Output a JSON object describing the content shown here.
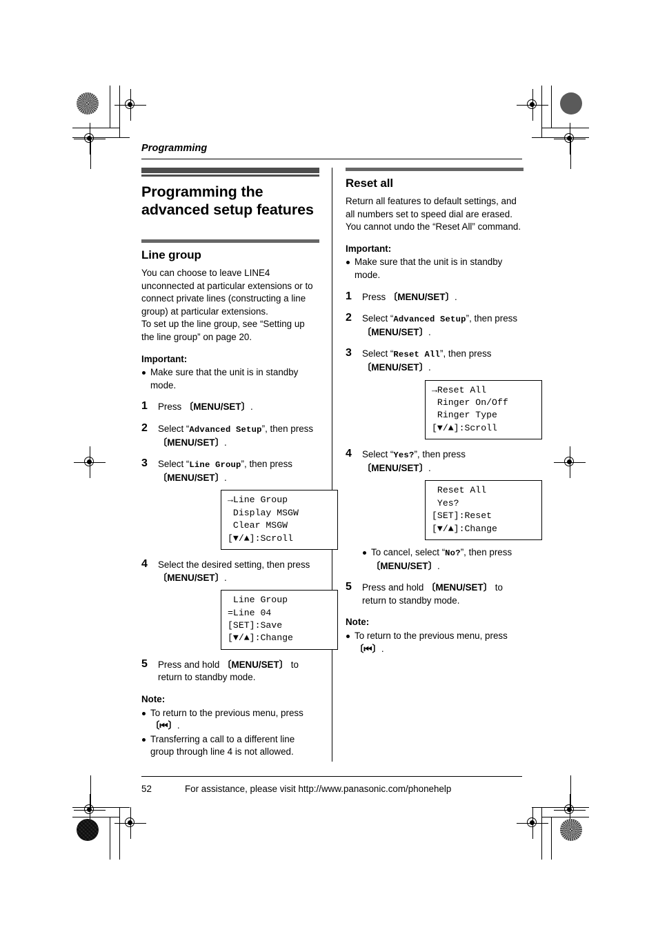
{
  "page": {
    "running_head": "Programming",
    "footer_page_number": "52",
    "footer_text": "For assistance, please visit http://www.panasonic.com/phonehelp"
  },
  "colors": {
    "heading_bar_dark": "#4d4d4d",
    "heading_bar_gray": "#666666",
    "rule": "#000000",
    "text": "#000000"
  },
  "left_column": {
    "title": "Programming the advanced setup features",
    "section": {
      "heading": "Line group",
      "intro": "You can choose to leave LINE4 unconnected at particular extensions or to connect private lines (constructing a line group) at particular extensions.\nTo set up the line group, see “Setting up the line group” on page 20.",
      "important_label": "Important:",
      "important_bullets": [
        "Make sure that the unit is in standby mode."
      ],
      "steps": [
        {
          "num": "1",
          "parts": [
            {
              "t": "text",
              "v": "Press "
            },
            {
              "t": "key",
              "v": "〔MENU/SET〕"
            },
            {
              "t": "text",
              "v": "."
            }
          ]
        },
        {
          "num": "2",
          "parts": [
            {
              "t": "text",
              "v": "Select “"
            },
            {
              "t": "mono",
              "v": "Advanced Setup"
            },
            {
              "t": "text",
              "v": "”, then press "
            },
            {
              "t": "key",
              "v": "〔MENU/SET〕"
            },
            {
              "t": "text",
              "v": "."
            }
          ]
        },
        {
          "num": "3",
          "parts": [
            {
              "t": "text",
              "v": "Select “"
            },
            {
              "t": "mono",
              "v": "Line Group"
            },
            {
              "t": "text",
              "v": "”, then press "
            },
            {
              "t": "key",
              "v": "〔MENU/SET〕"
            },
            {
              "t": "text",
              "v": "."
            }
          ],
          "lcd": [
            "→Line Group",
            " Display MSGW",
            " Clear MSGW",
            "[▼/▲]:Scroll"
          ]
        },
        {
          "num": "4",
          "parts": [
            {
              "t": "text",
              "v": "Select the desired setting, then press "
            },
            {
              "t": "key",
              "v": "〔MENU/SET〕"
            },
            {
              "t": "text",
              "v": "."
            }
          ],
          "lcd": [
            " Line Group",
            "=Line 04",
            "[SET]:Save",
            "[▼/▲]:Change"
          ]
        },
        {
          "num": "5",
          "parts": [
            {
              "t": "text",
              "v": "Press and hold "
            },
            {
              "t": "key",
              "v": "〔MENU/SET〕"
            },
            {
              "t": "text",
              "v": " to return to standby mode."
            }
          ]
        }
      ],
      "note_label": "Note:",
      "note_bullets": [
        {
          "pre": "To return to the previous menu, press ",
          "key": "〔⏮〕",
          "post": "."
        },
        {
          "pre": "Transferring a call to a different line group through line 4 is not allowed.",
          "key": "",
          "post": ""
        }
      ]
    }
  },
  "right_column": {
    "section": {
      "heading": "Reset all",
      "intro": "Return all features to default settings, and all numbers set to speed dial are erased. You cannot undo the “Reset All” command.",
      "important_label": "Important:",
      "important_bullets": [
        "Make sure that the unit is in standby mode."
      ],
      "steps": [
        {
          "num": "1",
          "parts": [
            {
              "t": "text",
              "v": "Press "
            },
            {
              "t": "key",
              "v": "〔MENU/SET〕"
            },
            {
              "t": "text",
              "v": "."
            }
          ]
        },
        {
          "num": "2",
          "parts": [
            {
              "t": "text",
              "v": "Select “"
            },
            {
              "t": "mono",
              "v": "Advanced Setup"
            },
            {
              "t": "text",
              "v": "”, then press "
            },
            {
              "t": "key",
              "v": "〔MENU/SET〕"
            },
            {
              "t": "text",
              "v": "."
            }
          ]
        },
        {
          "num": "3",
          "parts": [
            {
              "t": "text",
              "v": "Select “"
            },
            {
              "t": "mono",
              "v": "Reset All"
            },
            {
              "t": "text",
              "v": "”, then press "
            },
            {
              "t": "key",
              "v": "〔MENU/SET〕"
            },
            {
              "t": "text",
              "v": "."
            }
          ],
          "lcd": [
            "→Reset All",
            " Ringer On/Off",
            " Ringer Type",
            "[▼/▲]:Scroll"
          ]
        },
        {
          "num": "4",
          "parts": [
            {
              "t": "text",
              "v": "Select “"
            },
            {
              "t": "mono",
              "v": "Yes?"
            },
            {
              "t": "text",
              "v": "”, then press "
            },
            {
              "t": "key",
              "v": "〔MENU/SET〕"
            },
            {
              "t": "text",
              "v": "."
            }
          ],
          "lcd": [
            " Reset All",
            " Yes?",
            "[SET]:Reset",
            "[▼/▲]:Change"
          ],
          "sub_bullet": [
            {
              "t": "text",
              "v": "To cancel, select “"
            },
            {
              "t": "mono",
              "v": "No?"
            },
            {
              "t": "text",
              "v": "”, then press "
            },
            {
              "t": "key",
              "v": "〔MENU/SET〕"
            },
            {
              "t": "text",
              "v": "."
            }
          ]
        },
        {
          "num": "5",
          "parts": [
            {
              "t": "text",
              "v": "Press and hold "
            },
            {
              "t": "key",
              "v": "〔MENU/SET〕"
            },
            {
              "t": "text",
              "v": " to return to standby mode."
            }
          ]
        }
      ],
      "note_label": "Note:",
      "note_bullets": [
        {
          "pre": "To return to the previous menu, press ",
          "key": "〔⏮〕",
          "post": "."
        }
      ]
    }
  },
  "print_marks": {
    "registration_icon": "registration-target-icon",
    "halftone_icon": "halftone-density-patch-icon",
    "crop_icon": "crop-mark-icon"
  }
}
